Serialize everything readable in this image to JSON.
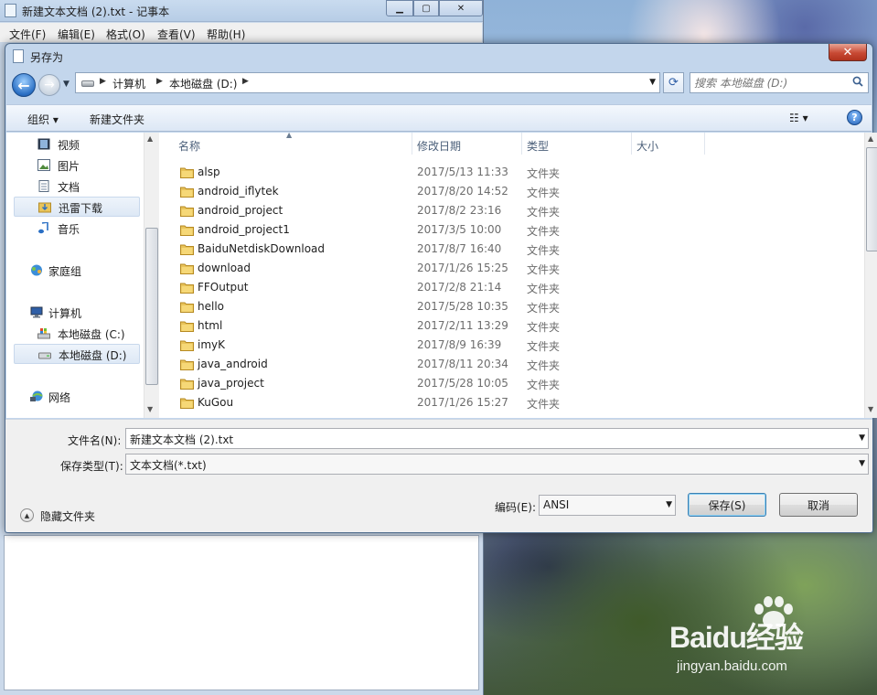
{
  "background_window": {
    "title": "新建文本文档 (2).txt - 记事本",
    "menu": [
      "文件(F)",
      "编辑(E)",
      "格式(O)",
      "查看(V)",
      "帮助(H)"
    ]
  },
  "dialog": {
    "title": "另存为",
    "address": {
      "crumbs": [
        "计算机",
        "本地磁盘 (D:)"
      ]
    },
    "search": {
      "placeholder": "搜索 本地磁盘 (D:)"
    },
    "toolbar": {
      "organize": "组织 ▾",
      "new_folder": "新建文件夹"
    },
    "sidebar": [
      {
        "label": "视频",
        "icon": "video-library-icon"
      },
      {
        "label": "图片",
        "icon": "pictures-library-icon"
      },
      {
        "label": "文档",
        "icon": "documents-library-icon"
      },
      {
        "label": "迅雷下载",
        "icon": "download-folder-icon",
        "selected": true
      },
      {
        "label": "音乐",
        "icon": "music-library-icon"
      },
      {
        "label": "家庭组",
        "icon": "homegroup-icon"
      },
      {
        "label": "计算机",
        "icon": "computer-icon"
      },
      {
        "label": "本地磁盘 (C:)",
        "icon": "windows-drive-icon"
      },
      {
        "label": "本地磁盘 (D:)",
        "icon": "drive-icon",
        "selected": true
      },
      {
        "label": "网络",
        "icon": "network-icon"
      }
    ],
    "columns": [
      "名称",
      "修改日期",
      "类型",
      "大小"
    ],
    "files": [
      {
        "name": "alsp",
        "date": "2017/5/13 11:33",
        "type": "文件夹"
      },
      {
        "name": "android_iflytek",
        "date": "2017/8/20 14:52",
        "type": "文件夹"
      },
      {
        "name": "android_project",
        "date": "2017/8/2 23:16",
        "type": "文件夹"
      },
      {
        "name": "android_project1",
        "date": "2017/3/5 10:00",
        "type": "文件夹"
      },
      {
        "name": "BaiduNetdiskDownload",
        "date": "2017/8/7 16:40",
        "type": "文件夹"
      },
      {
        "name": "download",
        "date": "2017/1/26 15:25",
        "type": "文件夹"
      },
      {
        "name": "FFOutput",
        "date": "2017/2/8 21:14",
        "type": "文件夹"
      },
      {
        "name": "hello",
        "date": "2017/5/28 10:35",
        "type": "文件夹"
      },
      {
        "name": "html",
        "date": "2017/2/11 13:29",
        "type": "文件夹"
      },
      {
        "name": "imyK",
        "date": "2017/8/9 16:39",
        "type": "文件夹"
      },
      {
        "name": "java_android",
        "date": "2017/8/11 20:34",
        "type": "文件夹"
      },
      {
        "name": "java_project",
        "date": "2017/5/28 10:05",
        "type": "文件夹"
      },
      {
        "name": "KuGou",
        "date": "2017/1/26 15:27",
        "type": "文件夹"
      }
    ],
    "filename_label": "文件名(N):",
    "filename_value": "新建文本文档 (2).txt",
    "filetype_label": "保存类型(T):",
    "filetype_value": "文本文档(*.txt)",
    "encoding_label": "编码(E):",
    "encoding_value": "ANSI",
    "save_button": "保存(S)",
    "cancel_button": "取消",
    "hide_folders": "隐藏文件夹"
  },
  "watermark": {
    "main": "Baidu经验",
    "sub": "jingyan.baidu.com"
  }
}
